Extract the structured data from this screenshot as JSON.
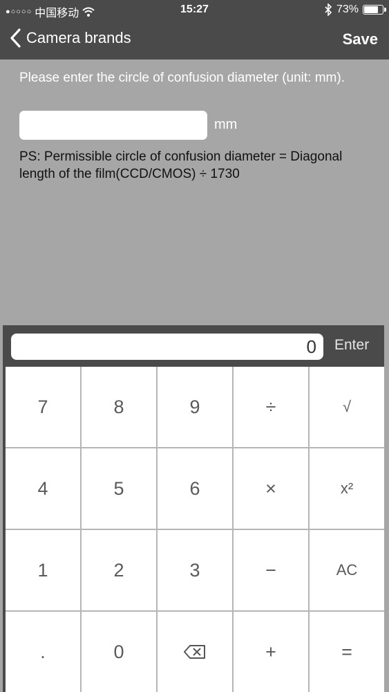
{
  "status_bar": {
    "carrier": "中国移动",
    "signal": "●○○○○",
    "time": "15:27",
    "battery_percent": "73%",
    "battery_level": 0.73,
    "wifi_icon": "wifi-icon",
    "bluetooth_icon": "bluetooth-icon"
  },
  "nav": {
    "back_label": "Camera brands",
    "save_label": "Save",
    "back_icon": "chevron-left-icon"
  },
  "form": {
    "prompt": "Please enter the circle of confusion diameter (unit: mm).",
    "input_value": "",
    "unit": "mm",
    "note": "PS: Permissible circle of confusion diameter = Diagonal length of the film(CCD/CMOS) ÷ 1730"
  },
  "keypad": {
    "display_value": "0",
    "enter_label": "Enter",
    "keys": [
      [
        "7",
        "8",
        "9",
        "÷",
        "√"
      ],
      [
        "4",
        "5",
        "6",
        "×",
        "x²"
      ],
      [
        "1",
        "2",
        "3",
        "−",
        "AC"
      ],
      [
        ".",
        "0",
        "⌫",
        "+",
        "="
      ]
    ]
  },
  "colors": {
    "bar_background": "#4a4a4a",
    "content_background": "#a7a6a7",
    "key_background": "#ffffff",
    "key_text": "#5a5a5a"
  }
}
